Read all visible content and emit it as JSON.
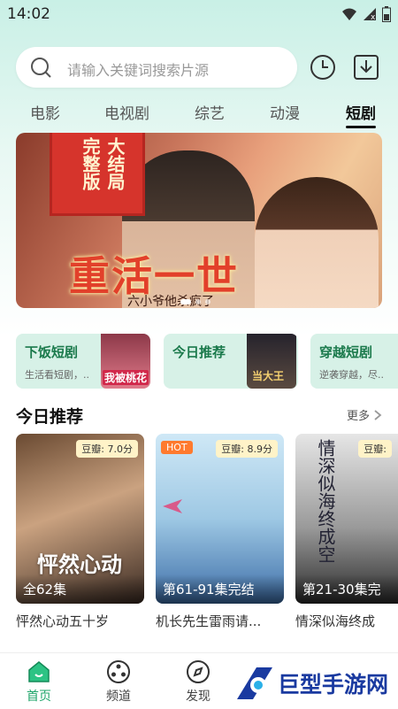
{
  "status": {
    "time": "14:02"
  },
  "search": {
    "placeholder": "请输入关键词搜索片源"
  },
  "tabs": [
    "电影",
    "电视剧",
    "综艺",
    "动漫",
    "短剧"
  ],
  "active_tab": "短剧",
  "banner": {
    "stamp_text": [
      "大结局",
      "完整版"
    ],
    "title": "重活一世",
    "subtitle": "六小爷他杀疯了"
  },
  "categories": [
    {
      "title": "下饭短剧",
      "subtitle": "生活看短剧，..",
      "thumb_text": "我被桃花"
    },
    {
      "title": "今日推荐",
      "subtitle": "",
      "thumb_text": "当大王"
    },
    {
      "title": "穿越短剧",
      "subtitle": "逆袭穿越，尽..",
      "thumb_text": ""
    }
  ],
  "section": {
    "title": "今日推荐",
    "more": "更多"
  },
  "cards": [
    {
      "score": "豆瓣: 7.0分",
      "hot": "",
      "overlay": "怦然心动",
      "episodes": "全62集",
      "name": "怦然心动五十岁"
    },
    {
      "score": "豆瓣: 8.9分",
      "hot": "HOT",
      "overlay": "",
      "episodes": "第61-91集完结",
      "name": "机长先生雷雨请..."
    },
    {
      "score": "豆瓣:",
      "hot": "",
      "overlay": "情深似海终成空",
      "episodes": "第21-30集完",
      "name": "情深似海终成"
    }
  ],
  "nav": [
    {
      "label": "首页",
      "icon": "home-icon"
    },
    {
      "label": "频道",
      "icon": "channel-icon"
    },
    {
      "label": "发现",
      "icon": "compass-icon"
    }
  ],
  "watermark": {
    "text": "巨型手游网"
  },
  "colors": {
    "accent": "#1fa56a",
    "category_bg": "#d7f1e7",
    "score_bg": "#fff3c8",
    "hot": "#ff7a2e"
  }
}
